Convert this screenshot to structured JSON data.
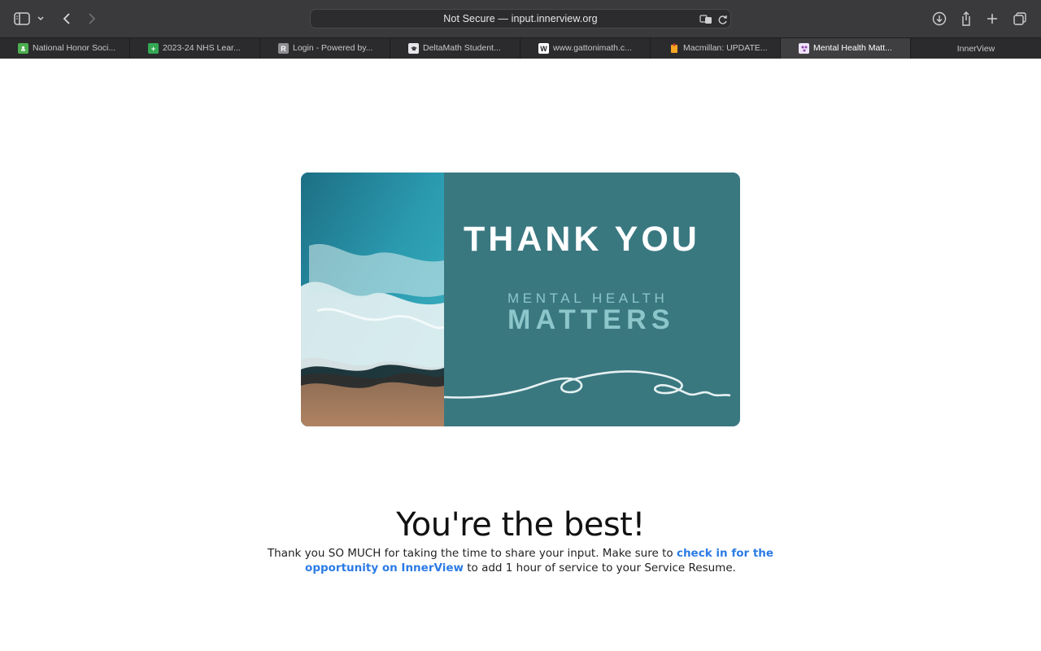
{
  "browser": {
    "address": "Not Secure — input.innerview.org",
    "tabs": [
      {
        "label": "National Honor Soci...",
        "favicon_color": "#4caf50",
        "favicon_glyph": ""
      },
      {
        "label": "2023-24 NHS Lear...",
        "favicon_color": "#34a853",
        "favicon_glyph": "+"
      },
      {
        "label": "Login - Powered by...",
        "favicon_color": "#8e8e93",
        "favicon_glyph": "R"
      },
      {
        "label": "DeltaMath Student...",
        "favicon_color": "#e5e5ea",
        "favicon_glyph": ""
      },
      {
        "label": "www.gattonimath.c...",
        "favicon_color": "#ffffff",
        "favicon_glyph": "W"
      },
      {
        "label": "Macmillan: UPDATE...",
        "favicon_color": "#f5a623",
        "favicon_glyph": ""
      },
      {
        "label": "Mental Health Matt...",
        "favicon_color": "#c9a8e8",
        "favicon_glyph": ""
      },
      {
        "label": "InnerView",
        "favicon_color": "",
        "favicon_glyph": ""
      }
    ],
    "active_tab_index": 6
  },
  "card": {
    "title": "THANK YOU",
    "subtitle_small": "MENTAL  HEALTH",
    "subtitle_big": "MATTERS",
    "background_color": "#3a7880",
    "accent_color": "#8cc6cb"
  },
  "content": {
    "headline": "You're the best!",
    "para_before": "Thank you SO MUCH for taking the time to share your input. Make sure to ",
    "link_text": "check in for the opportunity on InnerView",
    "para_after": " to add 1 hour of service to your Service Resume.",
    "link_color": "#2c7be5"
  }
}
